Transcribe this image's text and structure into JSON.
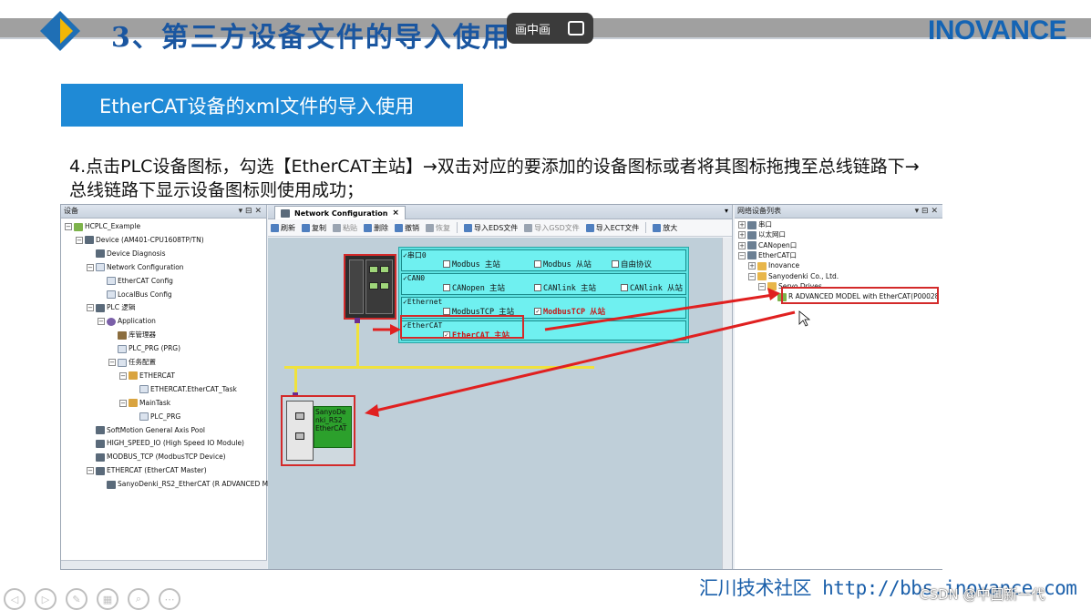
{
  "slide": {
    "title": "3、第三方设备文件的导入使用",
    "brand": "INOVANCE",
    "pip_label": "画中画",
    "subtitle": "EtherCAT设备的xml文件的导入使用",
    "instruction": "4.点击PLC设备图标，勾选【EtherCAT主站】→双击对应的要添加的设备图标或者将其图标拖拽至总线链路下→总线链路下显示设备图标则使用成功；",
    "footer": "汇川技术社区 http://bbs.inovance.com",
    "watermark": "CSDN @中国新一代",
    "footer_cn": "汇川技术社区",
    "footer_url": "http://bbs.inovance.com"
  },
  "colors": {
    "accent": "#1f8ad6",
    "brand": "#1464b4",
    "highlight": "#d32a2a",
    "protocol_bg": "#5fe3e3",
    "slave_bg": "#2ca02c"
  },
  "device_panel": {
    "title": "设备",
    "tree": [
      {
        "label": "HCPLC_Example",
        "level": 0,
        "toggle": "−",
        "icon": "project-icon"
      },
      {
        "label": "Device (AM401-CPU1608TP/TN)",
        "level": 1,
        "toggle": "−",
        "icon": "device-icon"
      },
      {
        "label": "Device Diagnosis",
        "level": 2,
        "toggle": "",
        "icon": "diagnosis-icon"
      },
      {
        "label": "Network Configuration",
        "level": 2,
        "toggle": "−",
        "icon": "network-config-icon"
      },
      {
        "label": "EtherCAT Config",
        "level": 3,
        "toggle": "",
        "icon": "config-icon"
      },
      {
        "label": "LocalBus Config",
        "level": 3,
        "toggle": "",
        "icon": "config-icon"
      },
      {
        "label": "PLC 逻辑",
        "level": 2,
        "toggle": "−",
        "icon": "plc-logic-icon"
      },
      {
        "label": "Application",
        "level": 3,
        "toggle": "−",
        "icon": "application-icon"
      },
      {
        "label": "库管理器",
        "level": 4,
        "toggle": "",
        "icon": "library-icon"
      },
      {
        "label": "PLC_PRG (PRG)",
        "level": 4,
        "toggle": "",
        "icon": "program-icon"
      },
      {
        "label": "任务配置",
        "level": 4,
        "toggle": "−",
        "icon": "task-config-icon"
      },
      {
        "label": "ETHERCAT",
        "level": 5,
        "toggle": "−",
        "icon": "task-icon"
      },
      {
        "label": "ETHERCAT.EtherCAT_Task",
        "level": 6,
        "toggle": "",
        "icon": "program-icon"
      },
      {
        "label": "MainTask",
        "level": 5,
        "toggle": "−",
        "icon": "task-icon"
      },
      {
        "label": "PLC_PRG",
        "level": 6,
        "toggle": "",
        "icon": "program-icon"
      },
      {
        "label": "SoftMotion General Axis Pool",
        "level": 2,
        "toggle": "",
        "icon": "axis-pool-icon"
      },
      {
        "label": "HIGH_SPEED_IO (High Speed IO Module)",
        "level": 2,
        "toggle": "",
        "icon": "io-module-icon"
      },
      {
        "label": "MODBUS_TCP (ModbusTCP Device)",
        "level": 2,
        "toggle": "",
        "icon": "modbus-device-icon"
      },
      {
        "label": "ETHERCAT (EtherCAT Master)",
        "level": 2,
        "toggle": "−",
        "icon": "ethercat-master-icon"
      },
      {
        "label": "SanyoDenki_RS2_EtherCAT (R ADVANCED M...",
        "level": 3,
        "toggle": "",
        "icon": "servo-icon"
      }
    ]
  },
  "editor": {
    "tab_label": "Network Configuration",
    "toolbar": [
      {
        "label": "刷新",
        "disabled": false
      },
      {
        "label": "复制",
        "disabled": false
      },
      {
        "label": "粘贴",
        "disabled": true
      },
      {
        "label": "删除",
        "disabled": false
      },
      {
        "label": "撤销",
        "disabled": false
      },
      {
        "label": "恢复",
        "disabled": true
      },
      {
        "label": "导入EDS文件",
        "disabled": false
      },
      {
        "label": "导入GSD文件",
        "disabled": true
      },
      {
        "label": "导入ECT文件",
        "disabled": false
      },
      {
        "label": "放大",
        "disabled": false
      }
    ],
    "groups": [
      {
        "name": "串口0",
        "options": [
          {
            "label": "Modbus 主站",
            "checked": false
          },
          {
            "label": "Modbus 从站",
            "checked": false
          },
          {
            "label": "自由协议",
            "checked": false
          }
        ]
      },
      {
        "name": "CAN0",
        "options": [
          {
            "label": "CANopen 主站",
            "checked": false
          },
          {
            "label": "CANlink 主站",
            "checked": false
          },
          {
            "label": "CANlink 从站",
            "checked": false
          }
        ]
      },
      {
        "name": "Ethernet",
        "options": [
          {
            "label": "ModbusTCP 主站",
            "checked": false
          },
          {
            "label": "ModbusTCP 从站",
            "checked": true
          }
        ]
      },
      {
        "name": "EtherCAT",
        "options": [
          {
            "label": "EtherCAT 主站",
            "checked": true
          }
        ]
      }
    ],
    "slave_label": "SanyoDenki_RS2_EtherCAT"
  },
  "net_panel": {
    "title": "网络设备列表",
    "tree": [
      {
        "label": "串口",
        "level": 0,
        "toggle": "+",
        "icon": "serial-icon"
      },
      {
        "label": "以太网口",
        "level": 0,
        "toggle": "+",
        "icon": "ethernet-icon"
      },
      {
        "label": "CANopen口",
        "level": 0,
        "toggle": "+",
        "icon": "canopen-icon"
      },
      {
        "label": "EtherCAT口",
        "level": 0,
        "toggle": "−",
        "icon": "ethercat-port-icon"
      },
      {
        "label": "Inovance",
        "level": 1,
        "toggle": "+",
        "icon": "folder-icon"
      },
      {
        "label": "Sanyodenki Co., Ltd.",
        "level": 1,
        "toggle": "−",
        "icon": "folder-icon"
      },
      {
        "label": "Servo Drives",
        "level": 2,
        "toggle": "−",
        "icon": "folder-icon"
      },
      {
        "label": "R ADVANCED MODEL with EtherCAT(P00028",
        "level": 3,
        "toggle": "",
        "icon": "servo-drive-icon"
      }
    ]
  }
}
